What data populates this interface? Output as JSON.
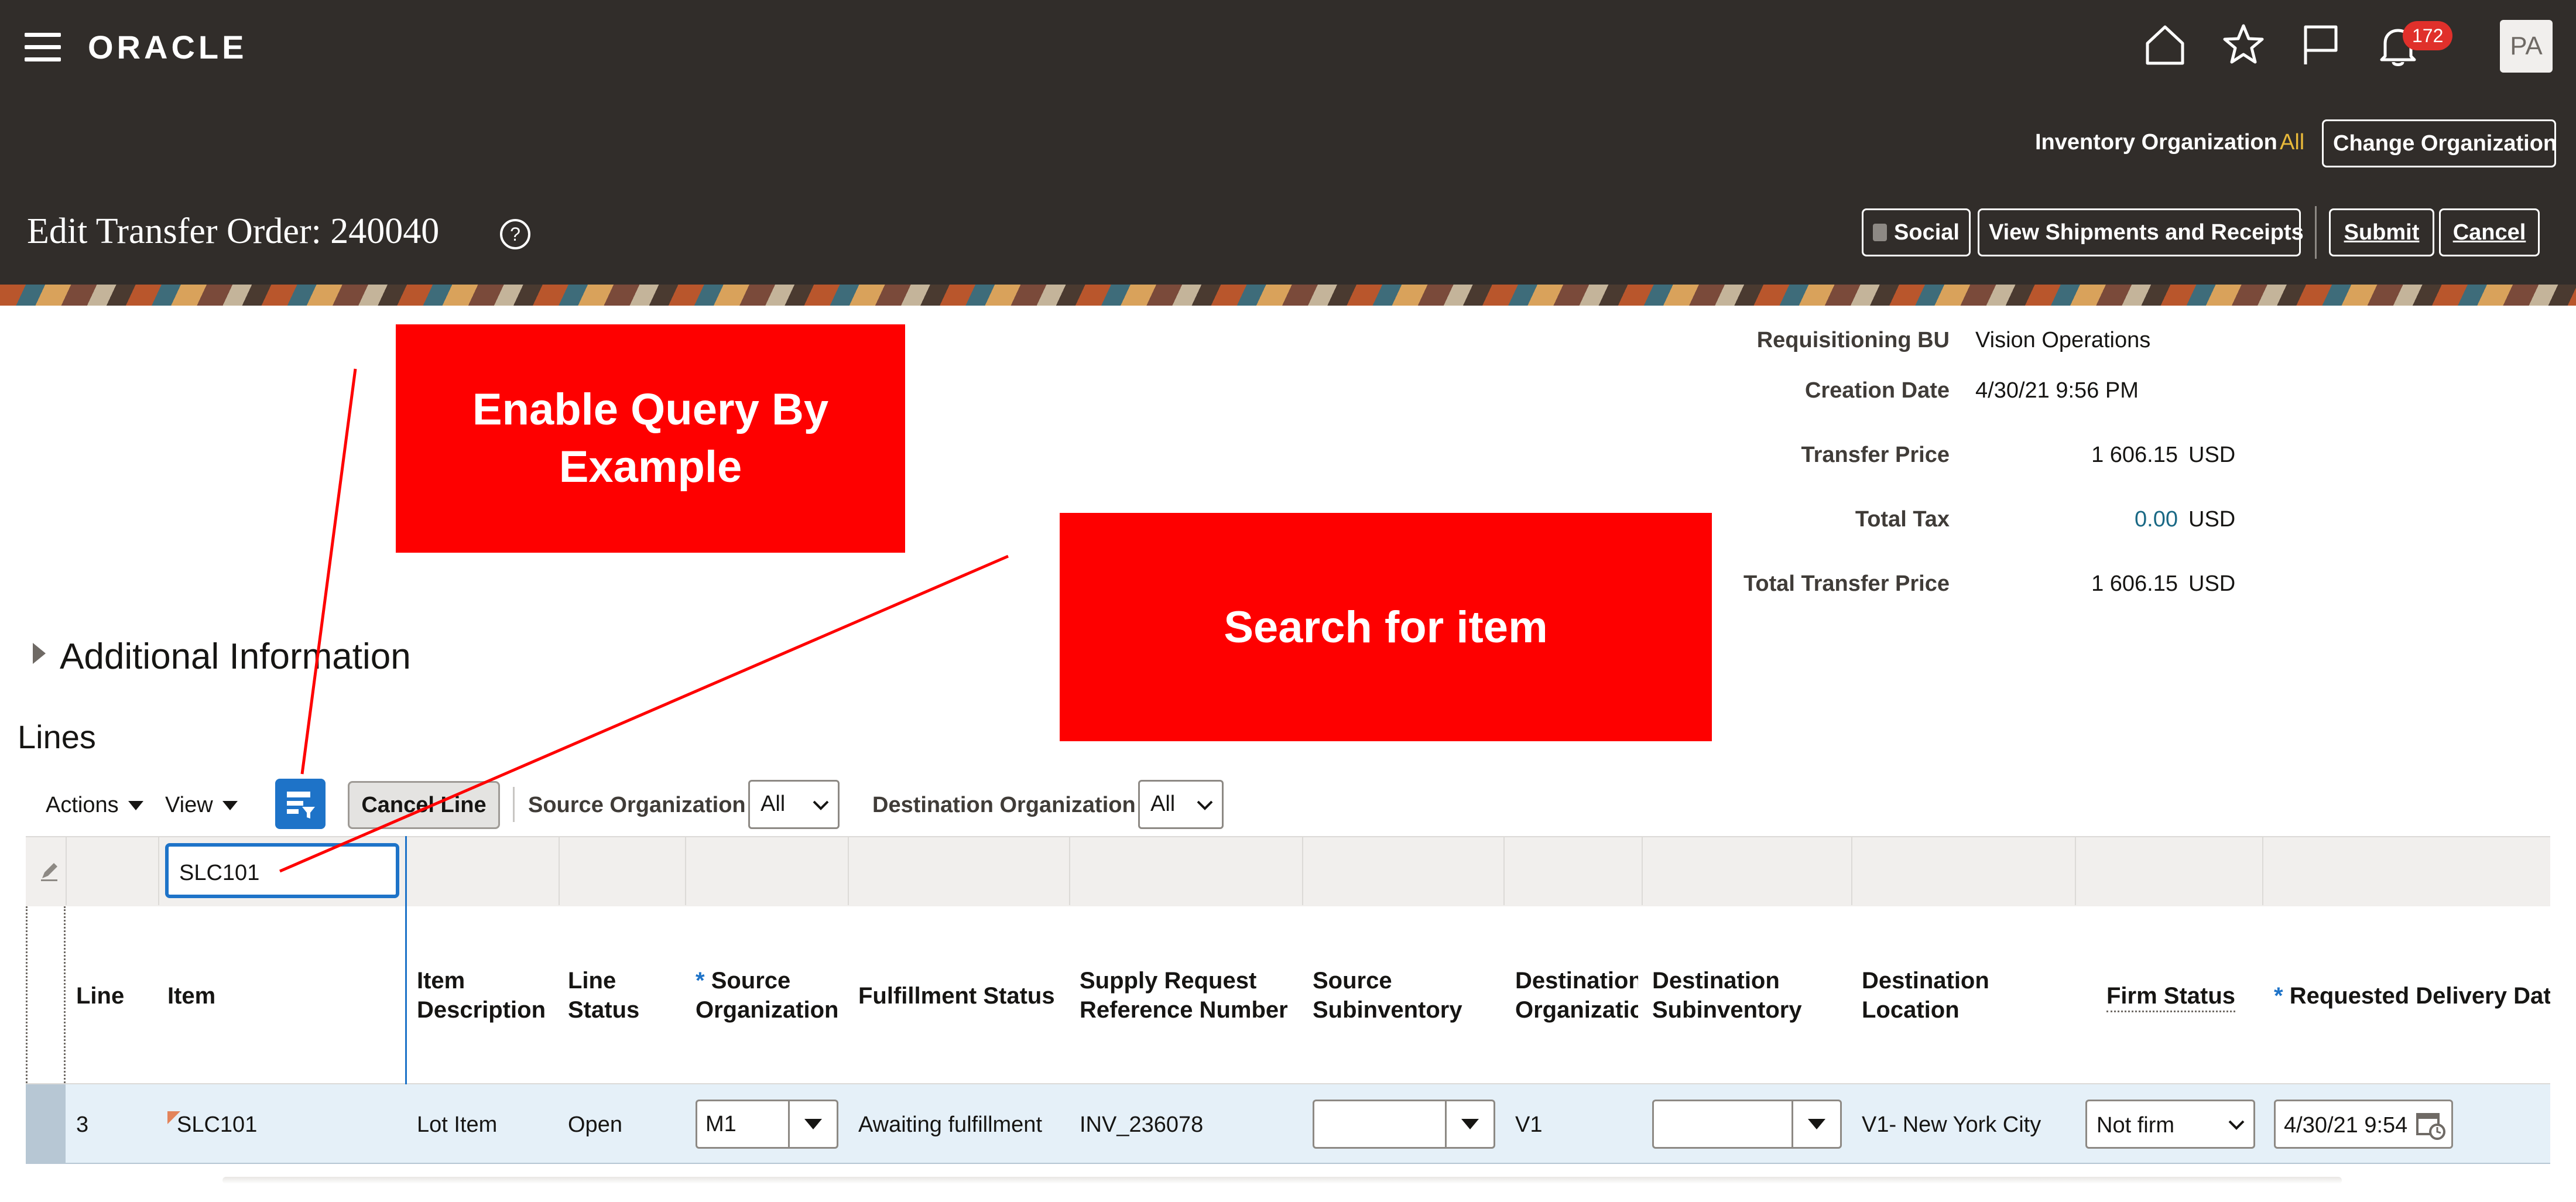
{
  "header": {
    "logo": "ORACLE",
    "notification_count": "172",
    "avatar_initials": "PA",
    "inventory_org_label": "Inventory Organization",
    "inventory_org_value": "All",
    "change_org_button": "Change Organization",
    "page_title": "Edit Transfer Order: 240040",
    "social_button": "Social",
    "view_shipments_button": "View Shipments and Receipts",
    "submit_button": "Submit",
    "cancel_button": "Cancel"
  },
  "summary": {
    "requisitioning_bu_label": "Requisitioning BU",
    "requisitioning_bu_value": "Vision Operations",
    "creation_date_label": "Creation Date",
    "creation_date_value": "4/30/21 9:56 PM",
    "transfer_price_label": "Transfer Price",
    "transfer_price_value": "1 606.15",
    "transfer_price_currency": "USD",
    "total_tax_label": "Total Tax",
    "total_tax_value": "0.00",
    "total_tax_currency": "USD",
    "total_transfer_price_label": "Total Transfer Price",
    "total_transfer_price_value": "1 606.15",
    "total_transfer_price_currency": "USD"
  },
  "annotations": {
    "qbe_callout": "Enable Query By Example",
    "search_callout": "Search for item"
  },
  "sections": {
    "additional_info": "Additional Information",
    "lines": "Lines"
  },
  "toolbar": {
    "actions": "Actions",
    "view": "View",
    "cancel_line": "Cancel Line",
    "source_org_label": "Source Organization",
    "source_org_value": "All",
    "dest_org_label": "Destination Organization",
    "dest_org_value": "All"
  },
  "qbe": {
    "item_filter_value": "SLC101"
  },
  "table": {
    "headers": {
      "line": "Line",
      "item": "Item",
      "item_description": [
        "Item",
        "Description"
      ],
      "line_status": [
        "Line",
        "Status"
      ],
      "source_org": [
        "Source",
        "Organization"
      ],
      "fulfillment_status": "Fulfillment Status",
      "supply_request": [
        "Supply Request",
        "Reference Number"
      ],
      "source_subinv": [
        "Source",
        "Subinventory"
      ],
      "destination_org": [
        "Destination",
        "Organizatio"
      ],
      "destination_subinv": [
        "Destination",
        "Subinventory"
      ],
      "destination_location": [
        "Destination",
        "Location"
      ],
      "firm_status": "Firm Status",
      "requested_delivery": "Requested Delivery Dat"
    },
    "row": {
      "line": "3",
      "item": "SLC101",
      "item_description": "Lot Item",
      "line_status": "Open",
      "source_org": "M1",
      "fulfillment_status": "Awaiting fulfillment",
      "supply_request": "INV_236078",
      "source_subinv": "",
      "destination_org": "V1",
      "destination_subinv": "",
      "destination_location": "V1- New York City",
      "firm_status": "Not firm",
      "requested_delivery": "4/30/21 9:54"
    }
  },
  "colors": {
    "header_bg": "#312d2a",
    "callout_red": "#fe0000",
    "link": "#1a6985",
    "qbe_button": "#1e73c8",
    "row_selected": "#e5f0f8"
  }
}
